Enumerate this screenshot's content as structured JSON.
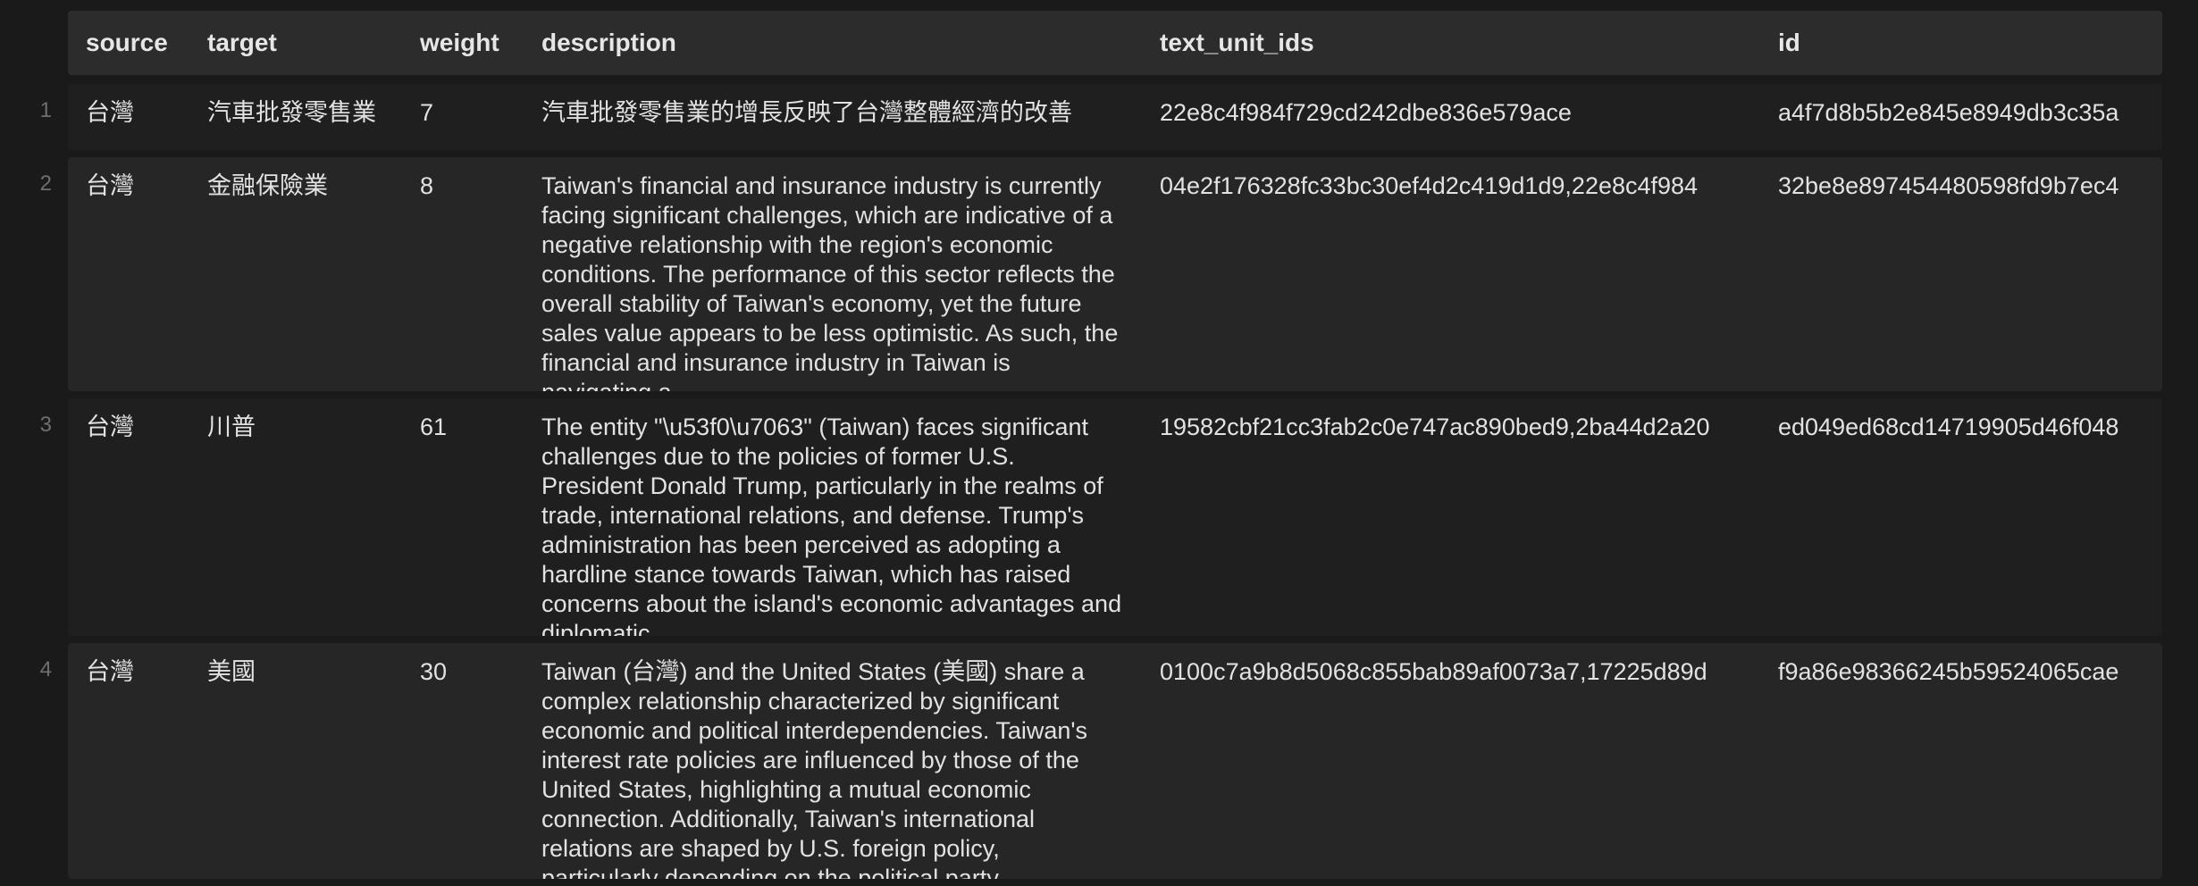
{
  "table": {
    "columns": [
      "source",
      "target",
      "weight",
      "description",
      "text_unit_ids",
      "id"
    ],
    "rows": [
      {
        "index": "1",
        "source": "台灣",
        "target": "汽車批發零售業",
        "weight": "7",
        "description": "汽車批發零售業的增長反映了台灣整體經濟的改善",
        "text_unit_ids": "22e8c4f984f729cd242dbe836e579ace",
        "id": "a4f7d8b5b2e845e8949db3c35a"
      },
      {
        "index": "2",
        "source": "台灣",
        "target": "金融保險業",
        "weight": "8",
        "description": "Taiwan's financial and insurance industry is currently facing significant challenges, which are indicative of a negative relationship with the region's economic conditions. The performance of this sector reflects the overall stability of Taiwan's economy, yet the future sales value appears to be less optimistic. As such, the financial and insurance industry in Taiwan is navigating a",
        "text_unit_ids": "04e2f176328fc33bc30ef4d2c419d1d9,22e8c4f984",
        "id": "32be8e897454480598fd9b7ec4"
      },
      {
        "index": "3",
        "source": "台灣",
        "target": "川普",
        "weight": "61",
        "description": "The entity \"\\u53f0\\u7063\" (Taiwan) faces significant challenges due to the policies of former U.S. President Donald Trump, particularly in the realms of trade, international relations, and defense. Trump's administration has been perceived as adopting a hardline stance towards Taiwan, which has raised concerns about the island's economic advantages and diplomatic",
        "text_unit_ids": "19582cbf21cc3fab2c0e747ac890bed9,2ba44d2a20",
        "id": "ed049ed68cd14719905d46f048"
      },
      {
        "index": "4",
        "source": "台灣",
        "target": "美國",
        "weight": "30",
        "description": "Taiwan (台灣) and the United States (美國) share a complex relationship characterized by significant economic and political interdependencies. Taiwan's interest rate policies are influenced by those of the United States, highlighting a mutual economic connection. Additionally, Taiwan's international relations are shaped by U.S. foreign policy, particularly depending on the political party",
        "text_unit_ids": "0100c7a9b8d5068c855bab89af0073a7,17225d89d",
        "id": "f9a86e98366245b59524065cae"
      }
    ]
  }
}
